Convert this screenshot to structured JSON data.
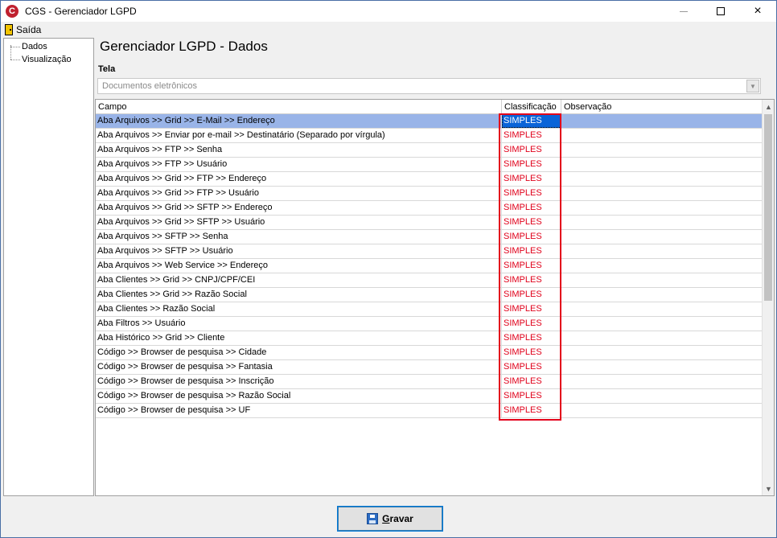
{
  "window": {
    "title": "CGS - Gerenciador LGPD",
    "icon": "cgs-logo-icon",
    "controls": {
      "minimize": "minimize-icon",
      "maximize": "maximize-icon",
      "close": "×"
    }
  },
  "menu": {
    "items": [
      {
        "label": "Saída",
        "icon": "door-exit-icon"
      }
    ]
  },
  "tree": {
    "items": [
      {
        "label": "Dados"
      },
      {
        "label": "Visualização"
      }
    ]
  },
  "main": {
    "heading": "Gerenciador LGPD - Dados",
    "tela_label": "Tela",
    "tela_value": "Documentos eletrônicos",
    "grid": {
      "columns": [
        "Campo",
        "Classificação",
        "Observação"
      ],
      "rows": [
        {
          "campo": "Aba Arquivos  >> Grid >> E-Mail >> Endereço",
          "classificacao": "SIMPLES",
          "observacao": "",
          "selected": true
        },
        {
          "campo": "Aba Arquivos >> Enviar por e-mail >> Destinatário (Separado por vírgula)",
          "classificacao": "SIMPLES",
          "observacao": ""
        },
        {
          "campo": "Aba Arquivos >> FTP >> Senha",
          "classificacao": "SIMPLES",
          "observacao": ""
        },
        {
          "campo": "Aba Arquivos >> FTP >> Usuário",
          "classificacao": "SIMPLES",
          "observacao": ""
        },
        {
          "campo": "Aba Arquivos >> Grid >> FTP >>  Endereço",
          "classificacao": "SIMPLES",
          "observacao": ""
        },
        {
          "campo": "Aba Arquivos >> Grid >> FTP >> Usuário",
          "classificacao": "SIMPLES",
          "observacao": ""
        },
        {
          "campo": "Aba Arquivos >> Grid >> SFTP >> Endereço",
          "classificacao": "SIMPLES",
          "observacao": ""
        },
        {
          "campo": "Aba Arquivos >> Grid >> SFTP >> Usuário",
          "classificacao": "SIMPLES",
          "observacao": ""
        },
        {
          "campo": "Aba Arquivos >> SFTP >> Senha",
          "classificacao": "SIMPLES",
          "observacao": ""
        },
        {
          "campo": "Aba Arquivos >> SFTP >> Usuário",
          "classificacao": "SIMPLES",
          "observacao": ""
        },
        {
          "campo": "Aba Arquivos >> Web Service >> Endereço",
          "classificacao": "SIMPLES",
          "observacao": ""
        },
        {
          "campo": "Aba Clientes >> Grid >> CNPJ/CPF/CEI",
          "classificacao": "SIMPLES",
          "observacao": ""
        },
        {
          "campo": "Aba Clientes >> Grid >> Razão Social",
          "classificacao": "SIMPLES",
          "observacao": ""
        },
        {
          "campo": "Aba Clientes >> Razão Social",
          "classificacao": "SIMPLES",
          "observacao": ""
        },
        {
          "campo": "Aba Filtros >> Usuário",
          "classificacao": "SIMPLES",
          "observacao": ""
        },
        {
          "campo": "Aba Histórico >> Grid >> Cliente",
          "classificacao": "SIMPLES",
          "observacao": ""
        },
        {
          "campo": "Código >> Browser de pesquisa >> Cidade",
          "classificacao": "SIMPLES",
          "observacao": ""
        },
        {
          "campo": "Código >> Browser de pesquisa >> Fantasia",
          "classificacao": "SIMPLES",
          "observacao": ""
        },
        {
          "campo": "Código >> Browser de pesquisa >> Inscrição",
          "classificacao": "SIMPLES",
          "observacao": ""
        },
        {
          "campo": "Código >> Browser de pesquisa >> Razão Social",
          "classificacao": "SIMPLES",
          "observacao": ""
        },
        {
          "campo": "Código >> Browser de pesquisa >> UF",
          "classificacao": "SIMPLES",
          "observacao": ""
        }
      ]
    }
  },
  "footer": {
    "save_label": "Gravar",
    "save_icon": "floppy-disk-icon"
  },
  "colors": {
    "classification_text": "#e0001a",
    "selection_row": "#99b4e8",
    "highlight_border": "#e3001b"
  }
}
